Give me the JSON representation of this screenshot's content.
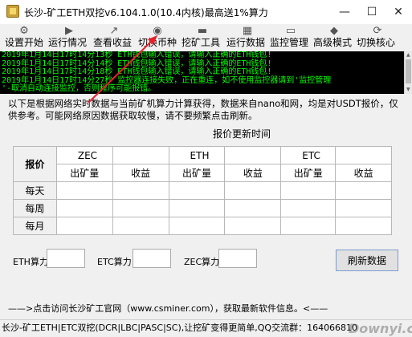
{
  "window": {
    "title": "长沙-矿工ETH双挖v6.104.1.0(10.4内核)最高送1%算力",
    "minimize": "—",
    "maximize": "☐",
    "close": "✕"
  },
  "toolbar": [
    {
      "label": "设置开始",
      "icon": "settings-icon"
    },
    {
      "label": "运行情况",
      "icon": "running-icon"
    },
    {
      "label": "查看收益",
      "icon": "chart-icon"
    },
    {
      "label": "切换币种",
      "icon": "coin-icon"
    },
    {
      "label": "挖矿工具",
      "icon": "toolbox-icon"
    },
    {
      "label": "运行数据",
      "icon": "data-icon"
    },
    {
      "label": "监控管理",
      "icon": "monitor-icon"
    },
    {
      "label": "高级模式",
      "icon": "advanced-icon"
    },
    {
      "label": "切换核心",
      "icon": "core-icon"
    }
  ],
  "log": {
    "lines": [
      "2019年1月14日17时14分13秒 ETH钱包输入错误，请输入正确的ETH钱包!",
      "2019年1月14日17时14分14秒 ETH钱包输入错误，请输入正确的ETH钱包!",
      "2019年1月14日17时14分18秒 ETH钱包输入错误，请输入正确的ETH钱包!",
      "2019年1月14日17时14分27秒 监控器连接失败，正在重连，如不使用监控器请到'监控管理",
      "'-取消自动连接监控，否则程序可能报错。"
    ],
    "color": "#00ff00"
  },
  "notice": "以下是根据网络实时数据与当前矿机算力计算获得，数据来自nano和网，均是对USDT报价，仅供参考。可能网络原因数据获取较慢，请不要频繁点击刷新。",
  "update_time_label": "报价更新时间",
  "table": {
    "corner": "报价",
    "coins": [
      "ZEC",
      "ETH",
      "ETC"
    ],
    "subheaders": [
      "出矿量",
      "收益"
    ],
    "rows": [
      "每天",
      "每周",
      "每月"
    ]
  },
  "hashrates": [
    {
      "label": "ETH算力",
      "value": ""
    },
    {
      "label": "ETC算力",
      "value": ""
    },
    {
      "label": "ZEC算力",
      "value": ""
    }
  ],
  "refresh_button": "刷新数据",
  "footer_link": "——>点击访问长沙矿工官网（www.csminer.com），获取最新软件信息。<——",
  "status_bar": "长沙-矿工ETH|ETC双挖(DCR|LBC|PASC|SC),让挖矿变得更简单,QQ交流群：164066810",
  "watermark": "Downyi.com"
}
